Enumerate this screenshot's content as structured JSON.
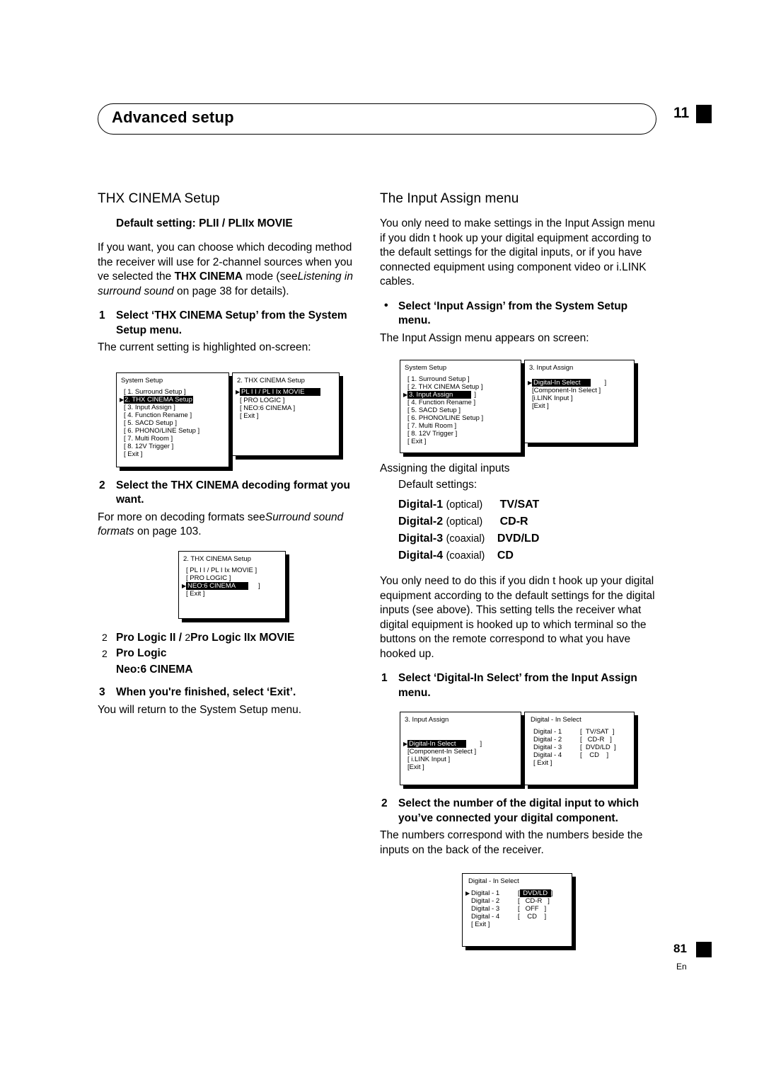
{
  "header": {
    "title": "Advanced setup",
    "chapter": "11"
  },
  "footer": {
    "page": "81",
    "lang": "En"
  },
  "left": {
    "section_title": "THX CINEMA Setup",
    "default_setting": "Default setting: PLII / PLIIx MOVIE",
    "intro": "If you want, you can choose which decoding method the receiver will use for 2-channel sources when you ve selected the THX CINEMA mode (see Listening in surround sound on page 38 for details).",
    "intro_parts": {
      "p1": "If you want, you can choose which decoding method the receiver will use for 2-channel sources when you ve selected the ",
      "b1": "THX CINEMA",
      "p2": " mode (see",
      "i1": "Listening in surround sound",
      "p3": " on page 38 for details)."
    },
    "step1_num": "1",
    "step1": "Select ‘THX CINEMA Setup’ from the System Setup menu.",
    "step1_sub": "The current setting is highlighted on-screen:",
    "step2_num": "2",
    "step2": "Select the THX CINEMA decoding format you want.",
    "step2_sub_p1": "For more on decoding formats see",
    "step2_sub_i": "Surround sound formats",
    "step2_sub_p2": " on page 103.",
    "options": [
      {
        "marker": "2",
        "label": "Pro Logic II / ",
        "marker2": "2",
        "label2": "Pro Logic IIx MOVIE"
      },
      {
        "marker": "2",
        "label": "Pro Logic"
      },
      {
        "marker": "",
        "label": "Neo:6 CINEMA"
      }
    ],
    "step3_num": "3",
    "step3": "When you're finished, select ‘Exit’.",
    "step3_sub": "You will return to the System Setup menu."
  },
  "right": {
    "section_title": "The Input Assign menu",
    "intro": "You only need to make settings in the Input Assign menu if you didn t hook up your digital equipment according to the default settings for the digital inputs, or if you have connected equipment using component video or i.LINK cables.",
    "bullet1": "Select ‘Input Assign’ from the System Setup menu.",
    "bullet1_sub": "The Input Assign menu appears on screen:",
    "assign_heading": "Assigning the digital inputs",
    "assign_sub": "Default settings:",
    "assign_list": [
      {
        "name": "Digital-1",
        "type": "(optical)",
        "value": "TV/SAT"
      },
      {
        "name": "Digital-2",
        "type": "(optical)",
        "value": "CD-R"
      },
      {
        "name": "Digital-3",
        "type": "(coaxial)",
        "value": "DVD/LD"
      },
      {
        "name": "Digital-4",
        "type": "(coaxial)",
        "value": "CD"
      }
    ],
    "para2": "You only need to do this if you didn t hook up your digital equipment according to the default settings for the digital inputs (see above). This setting tells the receiver what digital equipment is hooked up to which terminal so the buttons on the remote correspond to what you have hooked up.",
    "step1_num": "1",
    "step1": "Select ‘Digital-In Select’ from the Input Assign menu.",
    "step2_num": "2",
    "step2": "Select the number of the digital input to which you’ve connected your digital component.",
    "step2_sub": "The numbers correspond with the numbers beside the inputs on the back of the receiver."
  },
  "osd": {
    "system_setup": {
      "title": "System Setup",
      "rows": [
        "[ 1. Surround Setup      ]",
        "2. THX CINEMA Setup",
        "[ 3. Input Assign          ]",
        "[ 4. Function Rename    ]",
        "[ 5. SACD Setup           ]",
        "[ 6. PHONO/LINE Setup ]",
        "[ 7. Multi Room            ]",
        "[ 8. 12V Trigger            ]",
        "[ Exit                          ]"
      ],
      "highlight_index": 1
    },
    "thx_cinema_setup_1": {
      "title": "2. THX  CINEMA  Setup",
      "rows": [
        "PL I I / PL I Ix MOVIE",
        "[ PRO  LOGIC            ]",
        "[ NEO:6 CINEMA         ]",
        "[ Exit                        ]"
      ],
      "highlight_index": 0
    },
    "thx_cinema_setup_2": {
      "title": "2.  THX   CINEMA   Setup",
      "rows": [
        "[ PL I I / PL I Ix MOVIE  ]",
        "[ PRO  LOGIC                ]",
        "NEO:6 CINEMA",
        "[ Exit                            ]"
      ],
      "highlight_index": 2
    },
    "system_setup_2": {
      "title": "System Setup",
      "rows": [
        "[ 1. Surround Setup      ]",
        "[ 2. THX CINEMA Setup ]",
        "3. Input Assign",
        "[ 4. Function Rename    ]",
        "[ 5. SACD Setup           ]",
        "[ 6. PHONO/LINE Setup ]",
        "[ 7. Multi Room            ]",
        "[ 8. 12V Trigger            ]",
        "[ Exit                          ]"
      ],
      "highlight_index": 2
    },
    "input_assign_1": {
      "title": "3. Input  Assign",
      "rows": [
        "Digital-In Select",
        "[Component-In Select ]",
        "[i.LINK Input             ]",
        "[Exit                          ]"
      ],
      "highlight_index": 0
    },
    "input_assign_2": {
      "title": "3. Input  Assign",
      "rows": [
        "Digital-In Select",
        "[Component-In Select ]",
        "[ i.LINK Input            ]",
        "[Exit                          ]"
      ],
      "highlight_index": 0
    },
    "digital_in_select_1": {
      "title": "Digital - In  Select",
      "rows": [
        {
          "label": "Digital - 1",
          "value": "TV/SAT"
        },
        {
          "label": "Digital - 2",
          "value": "CD-R"
        },
        {
          "label": "Digital - 3",
          "value": "DVD/LD"
        },
        {
          "label": "Digital - 4",
          "value": "CD"
        }
      ],
      "exit": "[ Exit  ]",
      "highlight_index": -1
    },
    "digital_in_select_2": {
      "title": "Digital - In  Select",
      "rows": [
        {
          "label": "Digital - 1",
          "value": "DVD/LD"
        },
        {
          "label": "Digital - 2",
          "value": "CD-R"
        },
        {
          "label": "Digital - 3",
          "value": "OFF"
        },
        {
          "label": "Digital - 4",
          "value": "CD"
        }
      ],
      "exit": "[ Exit  ]",
      "highlight_index": 0
    }
  }
}
